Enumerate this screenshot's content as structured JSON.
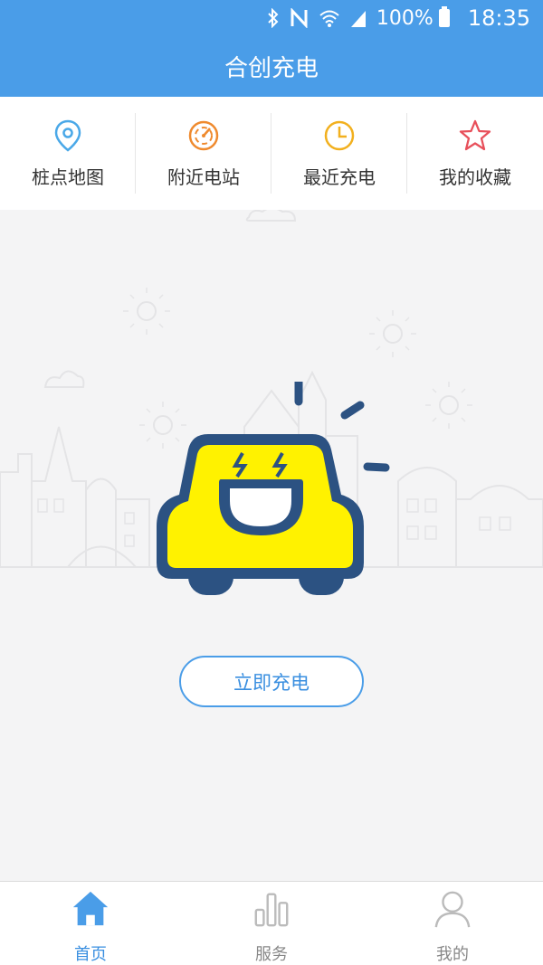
{
  "status_bar": {
    "battery": "100%",
    "time": "18:35",
    "icons": [
      "bluetooth-icon",
      "nfc-icon",
      "wifi-icon",
      "signal-icon",
      "battery-icon"
    ]
  },
  "app": {
    "title": "合创充电"
  },
  "quick_nav": [
    {
      "label": "桩点地图",
      "icon": "location-pin-icon",
      "color": "#4aa8e8"
    },
    {
      "label": "附近电站",
      "icon": "radar-icon",
      "color": "#ef8a2e"
    },
    {
      "label": "最近充电",
      "icon": "clock-icon",
      "color": "#f2b01e"
    },
    {
      "label": "我的收藏",
      "icon": "star-icon",
      "color": "#e8505b"
    }
  ],
  "main": {
    "mascot": "charging-car-mascot",
    "charge_button": "立即充电"
  },
  "tab_bar": [
    {
      "label": "首页",
      "icon": "home-icon",
      "active": true
    },
    {
      "label": "服务",
      "icon": "bar-chart-icon",
      "active": false
    },
    {
      "label": "我的",
      "icon": "user-icon",
      "active": false
    }
  ],
  "colors": {
    "primary": "#4a9de8",
    "mascot_body": "#fff200",
    "mascot_outline": "#2c5282"
  }
}
